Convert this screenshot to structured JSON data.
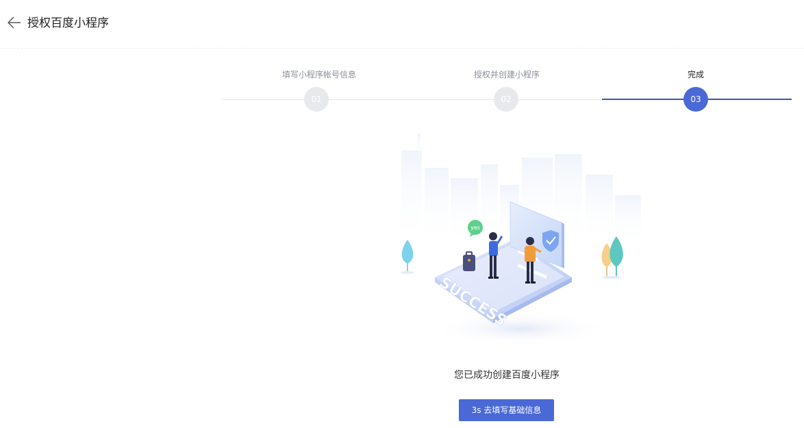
{
  "header": {
    "title": "授权百度小程序",
    "back_icon": "arrow-left-icon"
  },
  "steps": [
    {
      "label": "填写小程序帐号信息",
      "number": "01",
      "state": "done"
    },
    {
      "label": "授权并创建小程序",
      "number": "02",
      "state": "done"
    },
    {
      "label": "完成",
      "number": "03",
      "state": "active"
    }
  ],
  "colors": {
    "accent": "#4a69d6",
    "active_track": "#3a56b8",
    "inactive_circle": "#e8e9ec",
    "inactive_text": "#8a8e99"
  },
  "illustration": {
    "banner_text": "SUCCESS",
    "bubble_text": "yes"
  },
  "result": {
    "message": "您已成功创建百度小程序",
    "button_label": "3s 去填写基础信息"
  }
}
